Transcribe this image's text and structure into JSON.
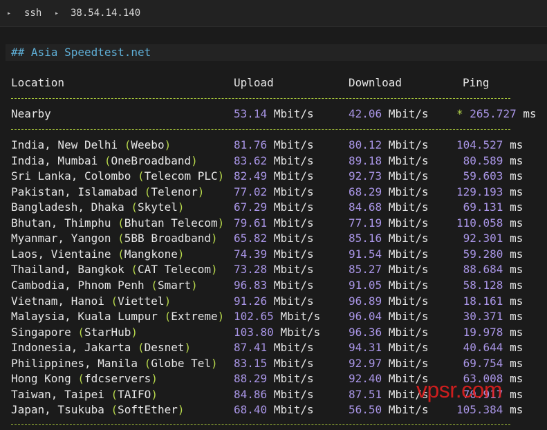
{
  "topbar": {
    "arrow1": "▸",
    "cmd": "ssh",
    "arrow2": "▸",
    "host": "38.54.14.140"
  },
  "section": {
    "heading": "## Asia Speedtest.net"
  },
  "table": {
    "headers": {
      "location": "Location",
      "upload": "Upload",
      "download": "Download",
      "ping": "Ping"
    },
    "unit_speed": "Mbit/s",
    "unit_ping": "ms",
    "nearby": {
      "label": "Nearby",
      "upload": "53.14",
      "download": "42.06",
      "star": "*",
      "ping": "265.727"
    },
    "rows": [
      {
        "place": "India, New Delhi",
        "provider": "Weebo",
        "upload": "81.76",
        "download": "80.12",
        "ping": "104.527"
      },
      {
        "place": "India, Mumbai",
        "provider": "OneBroadband",
        "upload": "83.62",
        "download": "89.18",
        "ping": "80.589"
      },
      {
        "place": "Sri Lanka, Colombo",
        "provider": "Telecom PLC",
        "upload": "82.49",
        "download": "92.73",
        "ping": "59.603"
      },
      {
        "place": "Pakistan, Islamabad",
        "provider": "Telenor",
        "upload": "77.02",
        "download": "68.29",
        "ping": "129.193"
      },
      {
        "place": "Bangladesh, Dhaka",
        "provider": "Skytel",
        "upload": "67.29",
        "download": "84.68",
        "ping": "69.131"
      },
      {
        "place": "Bhutan, Thimphu",
        "provider": "Bhutan Telecom",
        "upload": "79.61",
        "download": "77.19",
        "ping": "110.058"
      },
      {
        "place": "Myanmar, Yangon",
        "provider": "5BB Broadband",
        "upload": "65.82",
        "download": "85.16",
        "ping": "92.301"
      },
      {
        "place": "Laos, Vientaine",
        "provider": "Mangkone",
        "upload": "74.39",
        "download": "91.54",
        "ping": "59.280"
      },
      {
        "place": "Thailand, Bangkok",
        "provider": "CAT Telecom",
        "upload": "73.28",
        "download": "85.27",
        "ping": "88.684"
      },
      {
        "place": "Cambodia, Phnom Penh",
        "provider": "Smart",
        "upload": "96.83",
        "download": "91.05",
        "ping": "58.128"
      },
      {
        "place": "Vietnam, Hanoi",
        "provider": "Viettel",
        "upload": "91.26",
        "download": "96.89",
        "ping": "18.161"
      },
      {
        "place": "Malaysia, Kuala Lumpur",
        "provider": "Extreme",
        "upload": "102.65",
        "download": "96.04",
        "ping": "30.371"
      },
      {
        "place": "Singapore",
        "provider": "StarHub",
        "upload": "103.80",
        "download": "96.36",
        "ping": "19.978"
      },
      {
        "place": "Indonesia, Jakarta",
        "provider": "Desnet",
        "upload": "87.41",
        "download": "94.31",
        "ping": "40.644"
      },
      {
        "place": "Philippines, Manila",
        "provider": "Globe Tel",
        "upload": "83.15",
        "download": "92.97",
        "ping": "69.754"
      },
      {
        "place": "Hong Kong",
        "provider": "fdcservers",
        "upload": "88.29",
        "download": "92.40",
        "ping": "63.008"
      },
      {
        "place": "Taiwan, Taipei",
        "provider": "TAIFO",
        "upload": "84.86",
        "download": "87.51",
        "ping": "70.917"
      },
      {
        "place": "Japan, Tsukuba",
        "provider": "SoftEther",
        "upload": "68.40",
        "download": "56.50",
        "ping": "105.384"
      }
    ]
  },
  "watermark": {
    "text": "vpsr.com"
  },
  "colors": {
    "background": "#1b1b1b",
    "heading": "#5fafd7",
    "numbers": "#a995e6",
    "parens_and_dashes": "#b7d84b",
    "watermark": "#eb1e1e"
  }
}
